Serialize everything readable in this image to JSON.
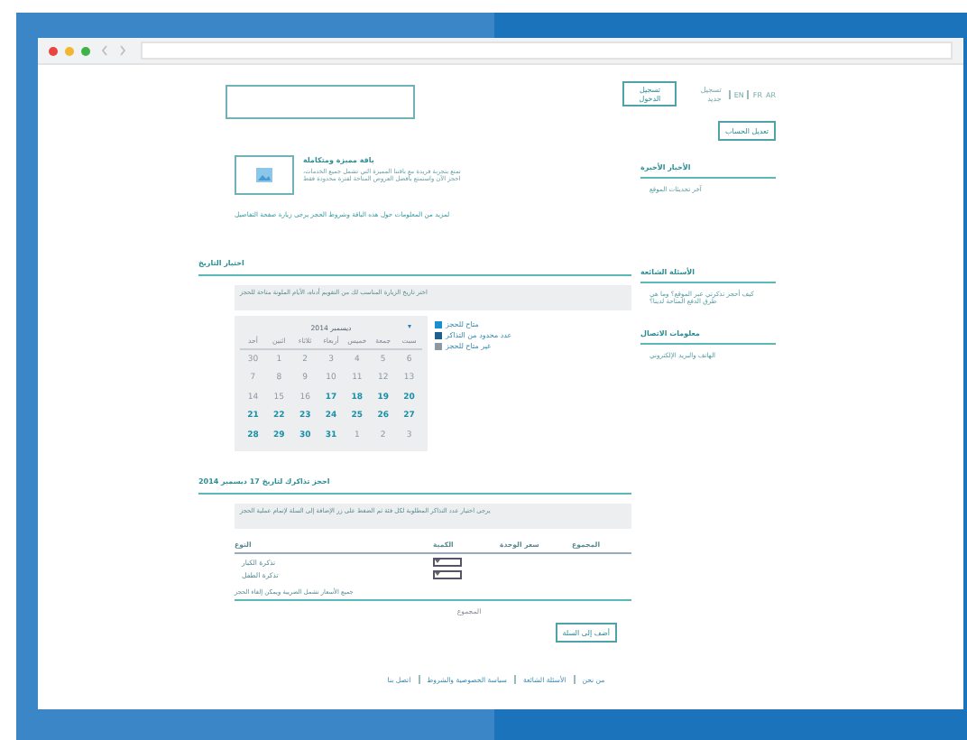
{
  "header": {
    "languages": [
      "AR",
      "FR",
      "EN"
    ],
    "register_link": "تسجيل جديد",
    "login_button": "تسجيل الدخول",
    "account_button": "تعديل الحساب"
  },
  "sidebar": [
    {
      "title": "الأخبار الأخيرة",
      "text": "آخر تحديثات الموقع"
    },
    {
      "title": "الأسئلة الشائعة",
      "text": "كيف أحجز تذكرتي عبر الموقع؟ وما هي طرق الدفع المتاحة لدينا؟"
    },
    {
      "title": "معلومات الاتصال",
      "text": "الهاتف والبريد الإلكتروني"
    }
  ],
  "product": {
    "title": "باقة مميزة ومتكاملة",
    "description": "تمتع بتجربة فريدة مع باقتنا المميزة التي تشمل جميع الخدمات، احجز الآن واستمتع بأفضل العروض المتاحة لفترة محدودة فقط",
    "link": "لمزيد من المعلومات حول هذه الباقة وشروط الحجز يرجى زيارة صفحة التفاصيل"
  },
  "calendar_section": {
    "title": "اختيار التاريخ",
    "notice": "اختر تاريخ الزيارة المناسب لك من التقويم أدناه، الأيام الملونة متاحة للحجز",
    "month": "ديسمبر 2014",
    "weekdays": [
      "سبت",
      "جمعة",
      "خميس",
      "أربعاء",
      "ثلاثاء",
      "اثنين",
      "أحد"
    ],
    "days": [
      {
        "label": "6",
        "available": false
      },
      {
        "label": "5",
        "available": false
      },
      {
        "label": "4",
        "available": false
      },
      {
        "label": "3",
        "available": false
      },
      {
        "label": "2",
        "available": false
      },
      {
        "label": "1",
        "available": false
      },
      {
        "label": "30",
        "available": false
      },
      {
        "label": "13",
        "available": false
      },
      {
        "label": "12",
        "available": false
      },
      {
        "label": "11",
        "available": false
      },
      {
        "label": "10",
        "available": false
      },
      {
        "label": "9",
        "available": false
      },
      {
        "label": "8",
        "available": false
      },
      {
        "label": "7",
        "available": false
      },
      {
        "label": "20",
        "available": true
      },
      {
        "label": "19",
        "available": true
      },
      {
        "label": "18",
        "available": true
      },
      {
        "label": "17",
        "available": true
      },
      {
        "label": "16",
        "available": false
      },
      {
        "label": "15",
        "available": false
      },
      {
        "label": "14",
        "available": false
      },
      {
        "label": "27",
        "available": true
      },
      {
        "label": "26",
        "available": true
      },
      {
        "label": "25",
        "available": true
      },
      {
        "label": "24",
        "available": true
      },
      {
        "label": "23",
        "available": true
      },
      {
        "label": "22",
        "available": true
      },
      {
        "label": "21",
        "available": true
      },
      {
        "label": "3",
        "available": false
      },
      {
        "label": "2",
        "available": false
      },
      {
        "label": "1",
        "available": false
      },
      {
        "label": "31",
        "available": true
      },
      {
        "label": "30",
        "available": true
      },
      {
        "label": "29",
        "available": true
      },
      {
        "label": "28",
        "available": true
      }
    ],
    "legend": [
      {
        "label": "متاح للحجز",
        "color": "#1a8fd0"
      },
      {
        "label": "عدد محدود من التذاكر",
        "color": "#1d5f8f"
      },
      {
        "label": "غير متاح للحجز",
        "color": "#8c99a3"
      }
    ]
  },
  "order_section": {
    "title": "احجز تذاكرك لتاريخ 17 ديسمبر 2014",
    "notice": "يرجى اختيار عدد التذاكر المطلوبة لكل فئة ثم الضغط على زر الإضافة إلى السلة لإتمام عملية الحجز",
    "columns": [
      "المجموع",
      "سعر الوحدة",
      "الكمية",
      "النوع"
    ],
    "rows": [
      {
        "product": "تذكرة الكبار"
      },
      {
        "product": "تذكرة الطفل"
      }
    ],
    "note": "جميع الأسعار تشمل الضريبة ويمكن إلغاء الحجز",
    "total": "المجموع",
    "submit": "أضف إلى السلة"
  },
  "footer": [
    "من نحن",
    "الأسئلة الشائعة",
    "سياسة الخصوصية والشروط",
    "اتصل بنا"
  ]
}
